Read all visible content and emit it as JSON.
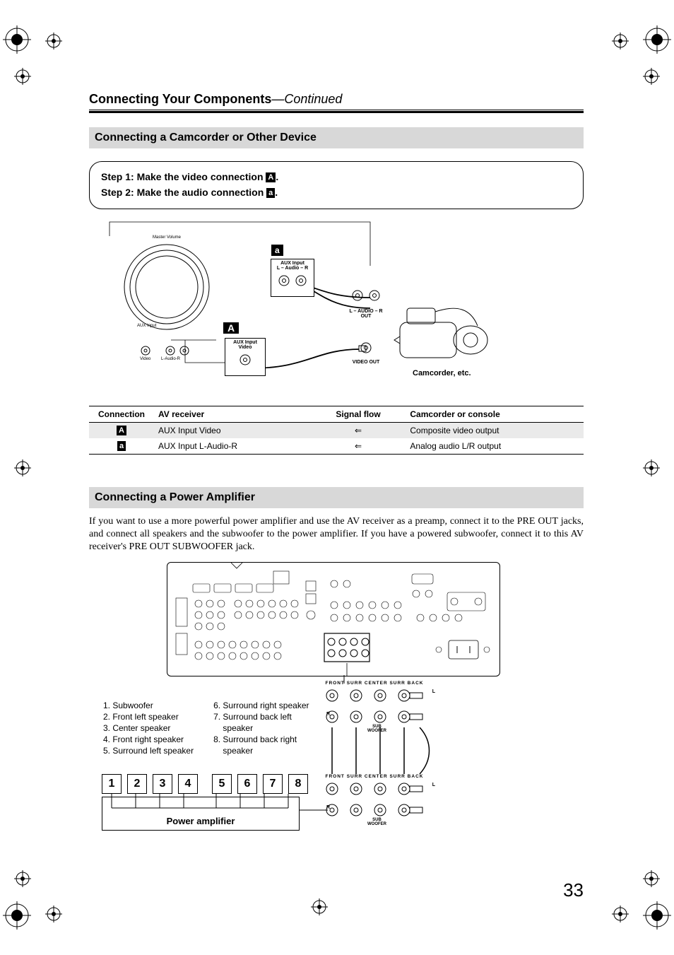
{
  "header": {
    "title_bold": "Connecting Your Components",
    "title_suffix": "—Continued"
  },
  "section1": {
    "bar": "Connecting a Camcorder or Other Device",
    "step1_prefix": "Step 1: Make the video connection ",
    "step1_tag": "A",
    "step1_suffix": ".",
    "step2_prefix": "Step 2: Make the audio connection ",
    "step2_tag": "a",
    "step2_suffix": ".",
    "diagram": {
      "tag_a_small": "a",
      "tag_a_big": "A",
      "aux_audio_box_line1": "AUX Input",
      "aux_audio_box_line2": "L – Audio – R",
      "aux_video_box_line1": "AUX Input",
      "aux_video_box_line2": "Video",
      "cam_audio_label": "L – AUDIO – R\nOUT",
      "cam_video_label": "VIDEO OUT",
      "camcorder_label": "Camcorder, etc.",
      "fp_top_line": "Master Volume",
      "fp_bottom_left": "AUX Input",
      "fp_bottom_v": "Video",
      "fp_bottom_a": "L-Audio-R"
    },
    "table": {
      "headers": [
        "Connection",
        "AV receiver",
        "Signal flow",
        "Camcorder or console"
      ],
      "rows": [
        {
          "tag": "A",
          "rx": "AUX Input Video",
          "flow": "⇐",
          "src": "Composite video output",
          "shaded": true
        },
        {
          "tag": "a",
          "rx": "AUX Input L-Audio-R",
          "flow": "⇐",
          "src": "Analog audio L/R output",
          "shaded": false
        }
      ]
    }
  },
  "section2": {
    "bar": "Connecting a Power Amplifier",
    "para": "If you want to use a more powerful power amplifier and use the AV receiver as a preamp, connect it to the PRE OUT jacks, and connect all speakers and the subwoofer to the power amplifier. If you have a powered subwoofer, connect it to this AV receiver's PRE OUT SUBWOOFER jack.",
    "speakers_left": [
      "1. Subwoofer",
      "2. Front left speaker",
      "3. Center speaker",
      "4. Front right speaker",
      "5. Surround left speaker"
    ],
    "speakers_right": [
      "6. Surround right speaker",
      "7. Surround back left",
      "    speaker",
      "8. Surround back right",
      "    speaker"
    ],
    "numbers": [
      "1",
      "2",
      "3",
      "4",
      "5",
      "6",
      "7",
      "8"
    ],
    "pa_label": "Power amplifier",
    "preout_labels": {
      "top": "FRONT   SURR   CENTER  SURR BACK",
      "l": "L",
      "r": "R",
      "sub": "SUB\nWOOFER"
    }
  },
  "page_number": "33"
}
